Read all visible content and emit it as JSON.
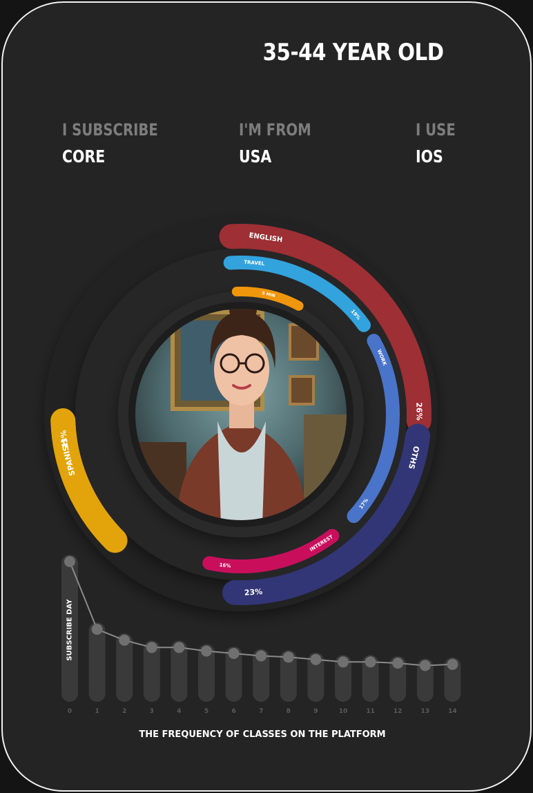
{
  "header": {
    "age_group": "35-44 YEAR OLD"
  },
  "profile": {
    "subscribe_label": "I SUBSCRIBE",
    "subscribe_value": "CORE",
    "from_label": "I'M FROM",
    "from_value": "USA",
    "use_label": "I USE",
    "use_value": "IOS"
  },
  "colors": {
    "background": "#242424",
    "english": "#9d2f35",
    "spanish": "#e2a40a",
    "other": "#323676",
    "travel": "#33a3dd",
    "work": "#4a74c9",
    "interest": "#c90f5c",
    "five_min": "#f0960c",
    "line": "#8a8a8a",
    "dot": "#707070",
    "bar": "#3a3a3a"
  },
  "chart_data": [
    {
      "type": "pie",
      "description_ring": "language",
      "slices": [
        {
          "label": "ENGLISH",
          "value": 26,
          "value_label": "26%"
        },
        {
          "label": "OTHS",
          "value": 23,
          "value_label": "23%"
        },
        {
          "label": "SPANISH",
          "value": 13,
          "value_label": "13%"
        }
      ]
    },
    {
      "type": "pie",
      "description_ring": "purpose",
      "slices": [
        {
          "label": "TRAVEL",
          "value": 19,
          "value_label": "19%"
        },
        {
          "label": "WORK",
          "value": 17,
          "value_label": "17%"
        },
        {
          "label": "INTEREST",
          "value": 16,
          "value_label": "16%"
        }
      ]
    },
    {
      "type": "pie",
      "description_ring": "duration",
      "slices": [
        {
          "label": "5 MIN",
          "value": 5
        }
      ]
    },
    {
      "type": "line",
      "title": "THE FREQUENCY OF CLASSES ON THE PLATFORM",
      "ylabel": "SUBSCRIBE DAY",
      "x": [
        0,
        1,
        2,
        3,
        4,
        5,
        6,
        7,
        8,
        9,
        10,
        11,
        12,
        13,
        14
      ],
      "values": [
        100,
        44,
        35,
        29,
        29,
        26,
        24,
        22,
        21,
        19,
        17,
        17,
        16,
        14,
        15
      ],
      "ylim": [
        0,
        100
      ]
    }
  ]
}
